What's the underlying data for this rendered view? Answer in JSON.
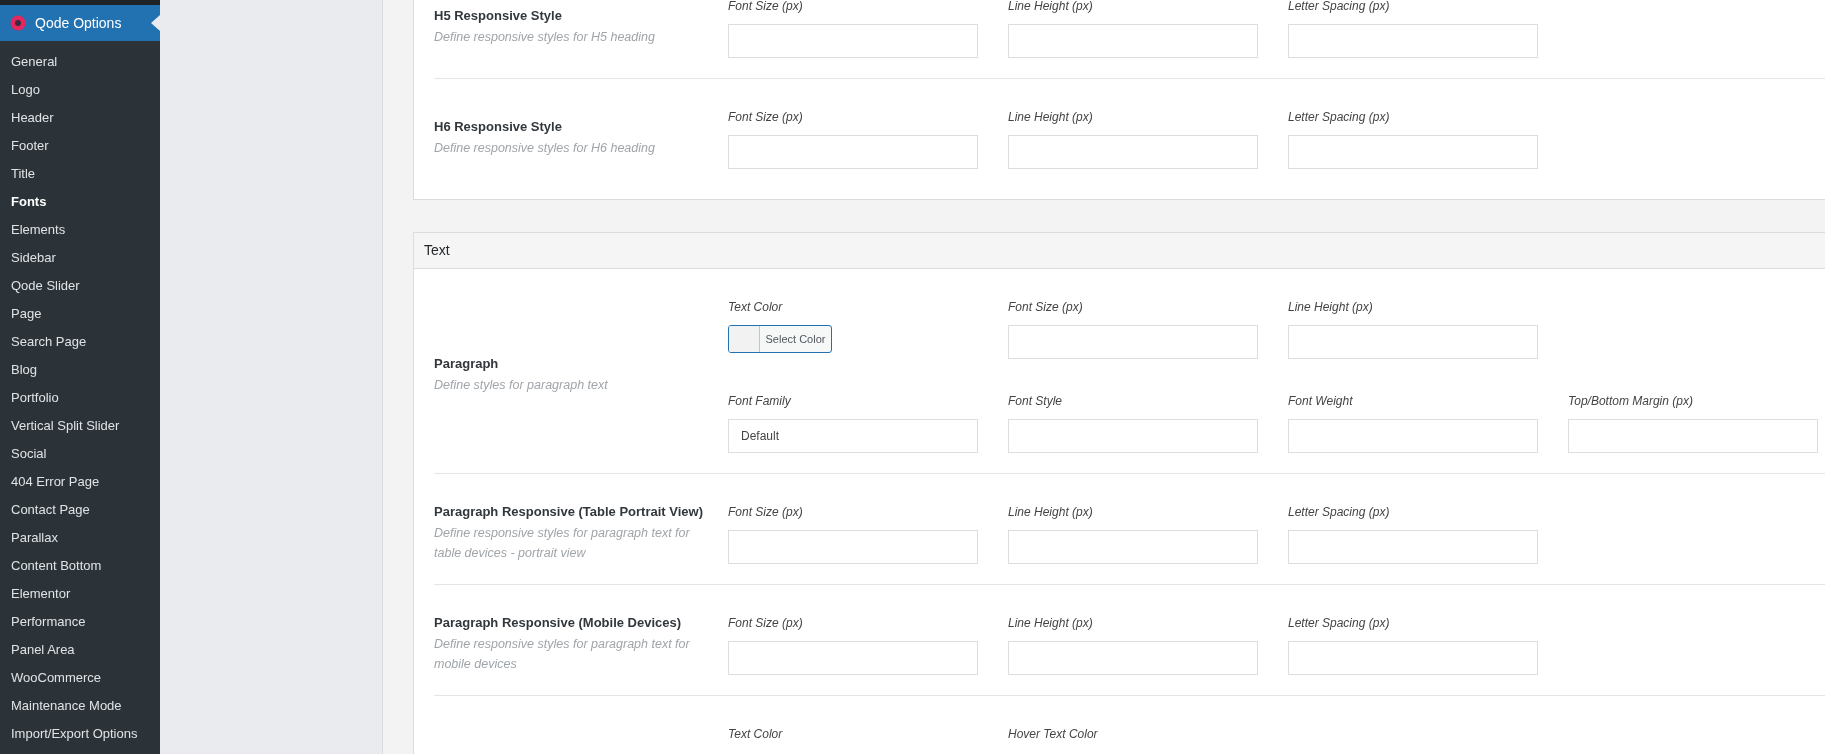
{
  "sidebar": {
    "header": {
      "title": "Qode Options"
    },
    "items": [
      {
        "label": "General",
        "selected": false
      },
      {
        "label": "Logo",
        "selected": false
      },
      {
        "label": "Header",
        "selected": false
      },
      {
        "label": "Footer",
        "selected": false
      },
      {
        "label": "Title",
        "selected": false
      },
      {
        "label": "Fonts",
        "selected": true
      },
      {
        "label": "Elements",
        "selected": false
      },
      {
        "label": "Sidebar",
        "selected": false
      },
      {
        "label": "Qode Slider",
        "selected": false
      },
      {
        "label": "Page",
        "selected": false
      },
      {
        "label": "Search Page",
        "selected": false
      },
      {
        "label": "Blog",
        "selected": false
      },
      {
        "label": "Portfolio",
        "selected": false
      },
      {
        "label": "Vertical Split Slider",
        "selected": false
      },
      {
        "label": "Social",
        "selected": false
      },
      {
        "label": "404 Error Page",
        "selected": false
      },
      {
        "label": "Contact Page",
        "selected": false
      },
      {
        "label": "Parallax",
        "selected": false
      },
      {
        "label": "Content Bottom",
        "selected": false
      },
      {
        "label": "Elementor",
        "selected": false
      },
      {
        "label": "Performance",
        "selected": false
      },
      {
        "label": "Panel Area",
        "selected": false
      },
      {
        "label": "WooCommerce",
        "selected": false
      },
      {
        "label": "Maintenance Mode",
        "selected": false
      },
      {
        "label": "Import/Export Options",
        "selected": false
      }
    ]
  },
  "sections": [
    {
      "rows": [
        {
          "title": "H5 Responsive Style",
          "description": "Define responsive styles for H5 heading",
          "field_groups": [
            [
              {
                "kind": "text",
                "label": "Font Size (px)"
              },
              {
                "kind": "text",
                "label": "Line Height (px)"
              },
              {
                "kind": "text",
                "label": "Letter Spacing (px)"
              }
            ]
          ]
        },
        {
          "title": "H6 Responsive Style",
          "description": "Define responsive styles for H6 heading",
          "field_groups": [
            [
              {
                "kind": "text",
                "label": "Font Size (px)"
              },
              {
                "kind": "text",
                "label": "Line Height (px)"
              },
              {
                "kind": "text",
                "label": "Letter Spacing (px)"
              }
            ]
          ]
        }
      ]
    },
    {
      "title": "Text",
      "rows": [
        {
          "title": "Paragraph",
          "description": "Define styles for paragraph text",
          "field_groups": [
            [
              {
                "kind": "color",
                "label": "Text Color",
                "button_label": "Select Color"
              },
              {
                "kind": "text",
                "label": "Font Size (px)"
              },
              {
                "kind": "text",
                "label": "Line Height (px)"
              }
            ],
            [
              {
                "kind": "text",
                "label": "Font Family",
                "value": "Default"
              },
              {
                "kind": "text",
                "label": "Font Style"
              },
              {
                "kind": "text",
                "label": "Font Weight"
              },
              {
                "kind": "text",
                "label": "Top/Bottom Margin (px)"
              }
            ]
          ]
        },
        {
          "title": "Paragraph Responsive (Table Portrait View)",
          "description": "Define responsive styles for paragraph text for table devices - portrait view",
          "field_groups": [
            [
              {
                "kind": "text",
                "label": "Font Size (px)"
              },
              {
                "kind": "text",
                "label": "Line Height (px)"
              },
              {
                "kind": "text",
                "label": "Letter Spacing (px)"
              }
            ]
          ]
        },
        {
          "title": "Paragraph Responsive (Mobile Devices)",
          "description": "Define responsive styles for paragraph text for mobile devices",
          "field_groups": [
            [
              {
                "kind": "text",
                "label": "Font Size (px)"
              },
              {
                "kind": "text",
                "label": "Line Height (px)"
              },
              {
                "kind": "text",
                "label": "Letter Spacing (px)"
              }
            ]
          ]
        },
        {
          "field_groups": [
            [
              {
                "kind": "label",
                "label": "Text Color"
              },
              {
                "kind": "label",
                "label": "Hover Text Color"
              }
            ]
          ]
        }
      ]
    }
  ]
}
